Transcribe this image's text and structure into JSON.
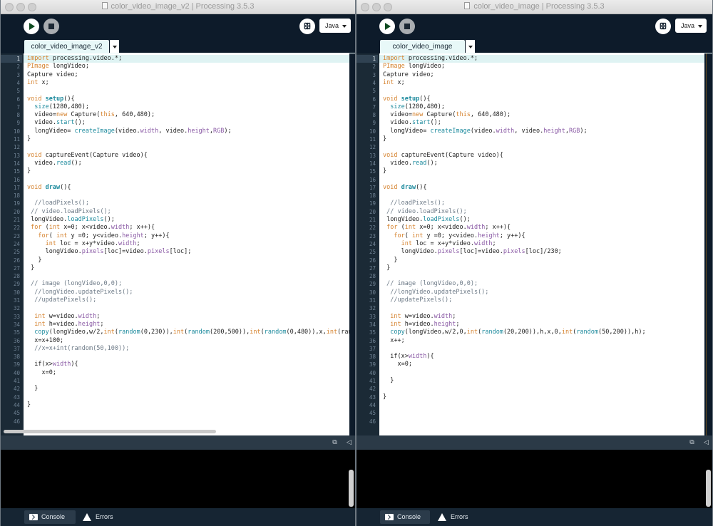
{
  "windows": [
    {
      "title": "color_video_image_v2 | Processing 3.5.3",
      "mode_label": "Java",
      "tab_label": "color_video_image_v2",
      "footer": {
        "console_label": "Console",
        "errors_label": "Errors"
      },
      "lines": [
        "import processing.video.*;",
        "PImage longVideo;",
        "Capture video;",
        "int x;",
        "",
        "void setup(){",
        "  size(1280,480);",
        "  video=new Capture(this, 640,480);",
        "  video.start();",
        "  longVideo= createImage(video.width, video.height,RGB);",
        "}",
        "",
        "void captureEvent(Capture video){",
        "  video.read();",
        "}",
        "",
        "void draw(){",
        "",
        "  //loadPixels();",
        " // video.loadPixels();",
        " longVideo.loadPixels();",
        " for (int x=0; x<video.width; x++){",
        "   for( int y =0; y<video.height; y++){",
        "     int loc = x+y*video.width;",
        "     longVideo.pixels[loc]=video.pixels[loc];",
        "   }",
        " }",
        "",
        " // image (longVideo,0,0);",
        "  //longVideo.updatePixels();",
        "  //updatePixels();",
        "",
        "  int w=video.width;",
        "  int h=video.height;",
        "  copy(longVideo,w/2,int(random(0,230)),int(random(200,500)),int(random(0,480)),x,int(ran",
        "  x=x+100;",
        "  //x=x+int(random(50,100));",
        "",
        "  if(x>width){",
        "    x=0;",
        "",
        "  }",
        "",
        "}",
        "",
        ""
      ]
    },
    {
      "title": "color_video_image | Processing 3.5.3",
      "mode_label": "Java",
      "tab_label": "color_video_image",
      "footer": {
        "console_label": "Console",
        "errors_label": "Errors"
      },
      "lines": [
        "import processing.video.*;",
        "PImage longVideo;",
        "Capture video;",
        "int x;",
        "",
        "void setup(){",
        "  size(1280,480);",
        "  video=new Capture(this, 640,480);",
        "  video.start();",
        "  longVideo= createImage(video.width, video.height,RGB);",
        "}",
        "",
        "void captureEvent(Capture video){",
        "  video.read();",
        "}",
        "",
        "void draw(){",
        "",
        "  //loadPixels();",
        " // video.loadPixels();",
        " longVideo.loadPixels();",
        " for (int x=0; x<video.width; x++){",
        "   for( int y =0; y<video.height; y++){",
        "     int loc = x+y*video.width;",
        "     longVideo.pixels[loc]=video.pixels[loc]/230;",
        "   }",
        " }",
        "",
        " // image (longVideo,0,0);",
        "  //longVideo.updatePixels();",
        "  //updatePixels();",
        "",
        "  int w=video.width;",
        "  int h=video.height;",
        "  copy(longVideo,w/2,0,int(random(20,200)),h,x,0,int(random(50,200)),h);",
        "  x++;",
        "",
        "  if(x>width){",
        "    x=0;",
        "",
        "  }",
        "",
        "}",
        "",
        "",
        ""
      ]
    }
  ],
  "colors": {
    "chrome": "#0d1b2a",
    "gutter": "#1b2a36",
    "current_line": "#dff3f3",
    "keyword": "#d5822e",
    "function": "#1c8a9d",
    "comment": "#6d7a87"
  },
  "icons": {
    "run": "play-icon",
    "stop": "stop-icon",
    "debug": "butterfly-debug-icon",
    "console": "terminal-icon",
    "errors": "warning-icon"
  }
}
